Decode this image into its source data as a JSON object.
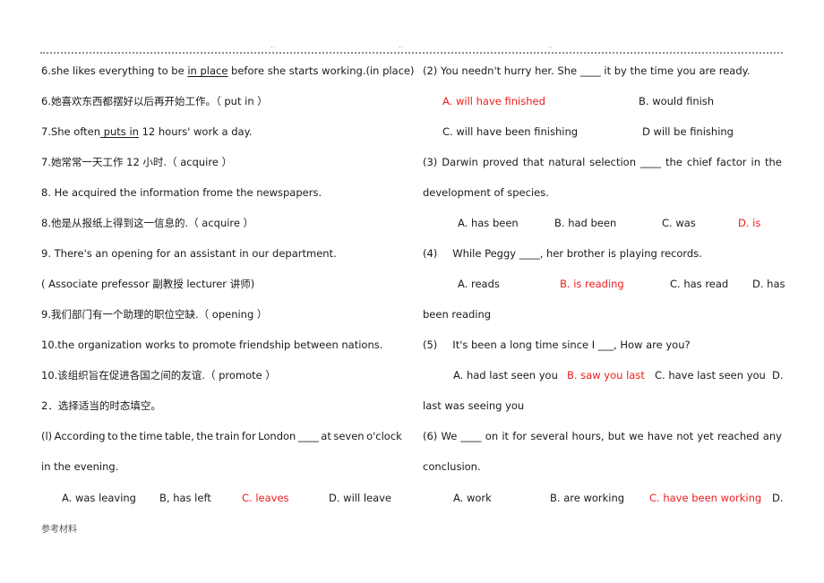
{
  "header": {
    "marks": [
      "..",
      "..",
      ".."
    ]
  },
  "left": {
    "l1": {
      "prefix": "6.she likes everything to be ",
      "underline": "in place",
      "suffix": " before she starts working.(in place)"
    },
    "l2": "6.她喜欢东西都摆好以后再开始工作。（ put in ）",
    "l3": {
      "prefix": "7.She often",
      "underline": " puts in",
      "suffix": " 12 hours' work a day."
    },
    "l4": "7.她常常一天工作 12 小时.（ acquire ）",
    "l5": "8. He acquired the information frome the newspapers.",
    "l6": "8.他是从报纸上得到这一信息的.（ acquire ）",
    "l7": "9. There's an opening for an assistant in our department.",
    "l8": "( Associate prefessor  副教授  lecturer  讲师)",
    "l9": "9.我们部门有一个助理的职位空缺.（ opening ）",
    "l10": "10.the organization works to promote friendship between nations.",
    "l11": "10.该组织旨在促进各国之间的友谊.（ promote ）",
    "l12": "2．选择适当的时态填空。",
    "q1": {
      "line1_words": [
        "(l)",
        "According",
        "to",
        "the",
        "time",
        "table,",
        "the",
        "train",
        "for",
        "London",
        "____",
        "at",
        "seven",
        "o'clock"
      ],
      "line2": "in the evening.",
      "options": [
        {
          "text": "A. was leaving",
          "correct": false
        },
        {
          "text": "B, has left",
          "correct": false
        },
        {
          "text": "C. leaves",
          "correct": true
        },
        {
          "text": "D. will leave",
          "correct": false
        }
      ]
    }
  },
  "right": {
    "q2": {
      "stem": "(2) You needn't hurry her. She ____ it by the time you are ready.",
      "options": [
        {
          "text": "A. will have finished",
          "correct": true
        },
        {
          "text": "B. would finish",
          "correct": false
        },
        {
          "text": "C. will have been finishing",
          "correct": false
        },
        {
          "text": "D will be finishing",
          "correct": false
        }
      ]
    },
    "q3": {
      "line1_words": [
        "(3)",
        "Darwin",
        "proved",
        "that",
        "natural",
        "selection",
        "____",
        "the",
        "chief",
        "factor",
        "in",
        "the"
      ],
      "line2": "development of species.",
      "options": [
        {
          "text": "A. has been",
          "correct": false
        },
        {
          "text": "B. had been",
          "correct": false
        },
        {
          "text": "C. was",
          "correct": false
        },
        {
          "text": "D. is",
          "correct": true
        }
      ]
    },
    "q4": {
      "stem_num": "(4)",
      "stem": "While Peggy ____, her brother is playing records.",
      "options": [
        {
          "text": "A. reads",
          "correct": false
        },
        {
          "text": "B. is reading",
          "correct": true
        },
        {
          "text": "C. has read",
          "correct": false
        },
        {
          "text": "D. has",
          "correct": false
        }
      ],
      "wrap": "been reading"
    },
    "q5": {
      "stem_num": "(5)",
      "stem": "It's been a long time since I ___, How are you?",
      "options": [
        {
          "text": "A. had last seen you",
          "correct": false
        },
        {
          "text": "B. saw you last",
          "correct": true
        },
        {
          "text": "C. have last seen you",
          "correct": false
        },
        {
          "text": "D.",
          "correct": false
        }
      ],
      "wrap": "last was seeing you"
    },
    "q6": {
      "line1_words": [
        "(6)",
        "We",
        "____",
        "on",
        "it",
        "for",
        "several",
        "hours,",
        "but",
        "we",
        "have",
        "not",
        "yet",
        "reached",
        "any"
      ],
      "line2": "conclusion.",
      "options": [
        {
          "text": "A. work",
          "correct": false
        },
        {
          "text": "B. are working",
          "correct": false
        },
        {
          "text": "C. have been working",
          "correct": true
        },
        {
          "text": "D.",
          "correct": false
        }
      ]
    }
  },
  "footer": {
    "text": "参考材料"
  },
  "colors": {
    "correct": "#ee1c1c",
    "text": "#1a1a1a",
    "rule": "#8f8f8f"
  }
}
